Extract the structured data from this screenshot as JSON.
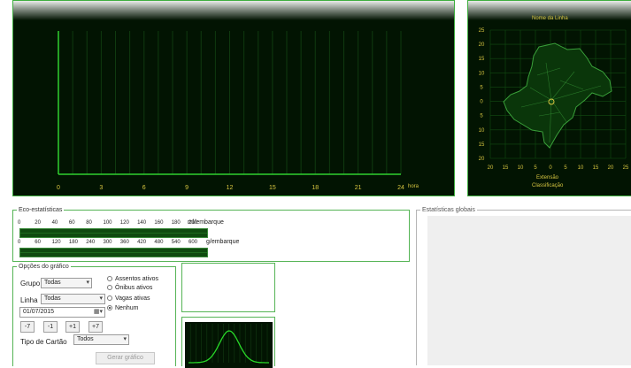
{
  "hourly_chart": {
    "x_ticks": [
      "0",
      "3",
      "6",
      "9",
      "12",
      "15",
      "18",
      "21",
      "24"
    ],
    "x_unit": "hora"
  },
  "map_panel": {
    "title": "Nome da Linha",
    "y_ticks": [
      "25",
      "20",
      "15",
      "10",
      "5",
      "0",
      "5",
      "10",
      "15",
      "20"
    ],
    "x_ticks": [
      "20",
      "15",
      "10",
      "5",
      "0",
      "5",
      "10",
      "15",
      "20",
      "25"
    ],
    "extensao_label": "Extensão",
    "classificacao_label": "Classificação"
  },
  "eco": {
    "legend": "Eco-estatísticas",
    "ml_scale": [
      "0",
      "20",
      "40",
      "60",
      "80",
      "100",
      "120",
      "140",
      "160",
      "180",
      "200"
    ],
    "ml_unit": "ml/embarque",
    "g_scale": [
      "0",
      "60",
      "120",
      "180",
      "240",
      "300",
      "360",
      "420",
      "480",
      "540",
      "600"
    ],
    "g_unit": "g/embarque"
  },
  "global_stats": {
    "legend": "Estatísticas globais"
  },
  "options": {
    "legend": "Opções do gráfico",
    "grupo_label": "Grupo",
    "grupo_value": "Todas",
    "linha_label": "Linha",
    "linha_value": "Todas",
    "date_value": "01/07/2015",
    "radio_assentos": "Assentos ativos",
    "radio_onibus": "Ônibus ativos",
    "radio_vagas": "Vagas ativas",
    "radio_nenhum": "Nenhum",
    "btn_minus7": "-7",
    "btn_minus1": "-1",
    "btn_plus1": "+1",
    "btn_plus7": "+7",
    "tipo_cartao_label": "Tipo de Cartão",
    "tipo_cartao_value": "Todos",
    "gerar_button": "Gerar gráfico"
  },
  "colors": {
    "panel_bg": "#021402",
    "accent_green": "#3fae3f",
    "axis_label": "#d8c640",
    "curve": "#28d828"
  }
}
